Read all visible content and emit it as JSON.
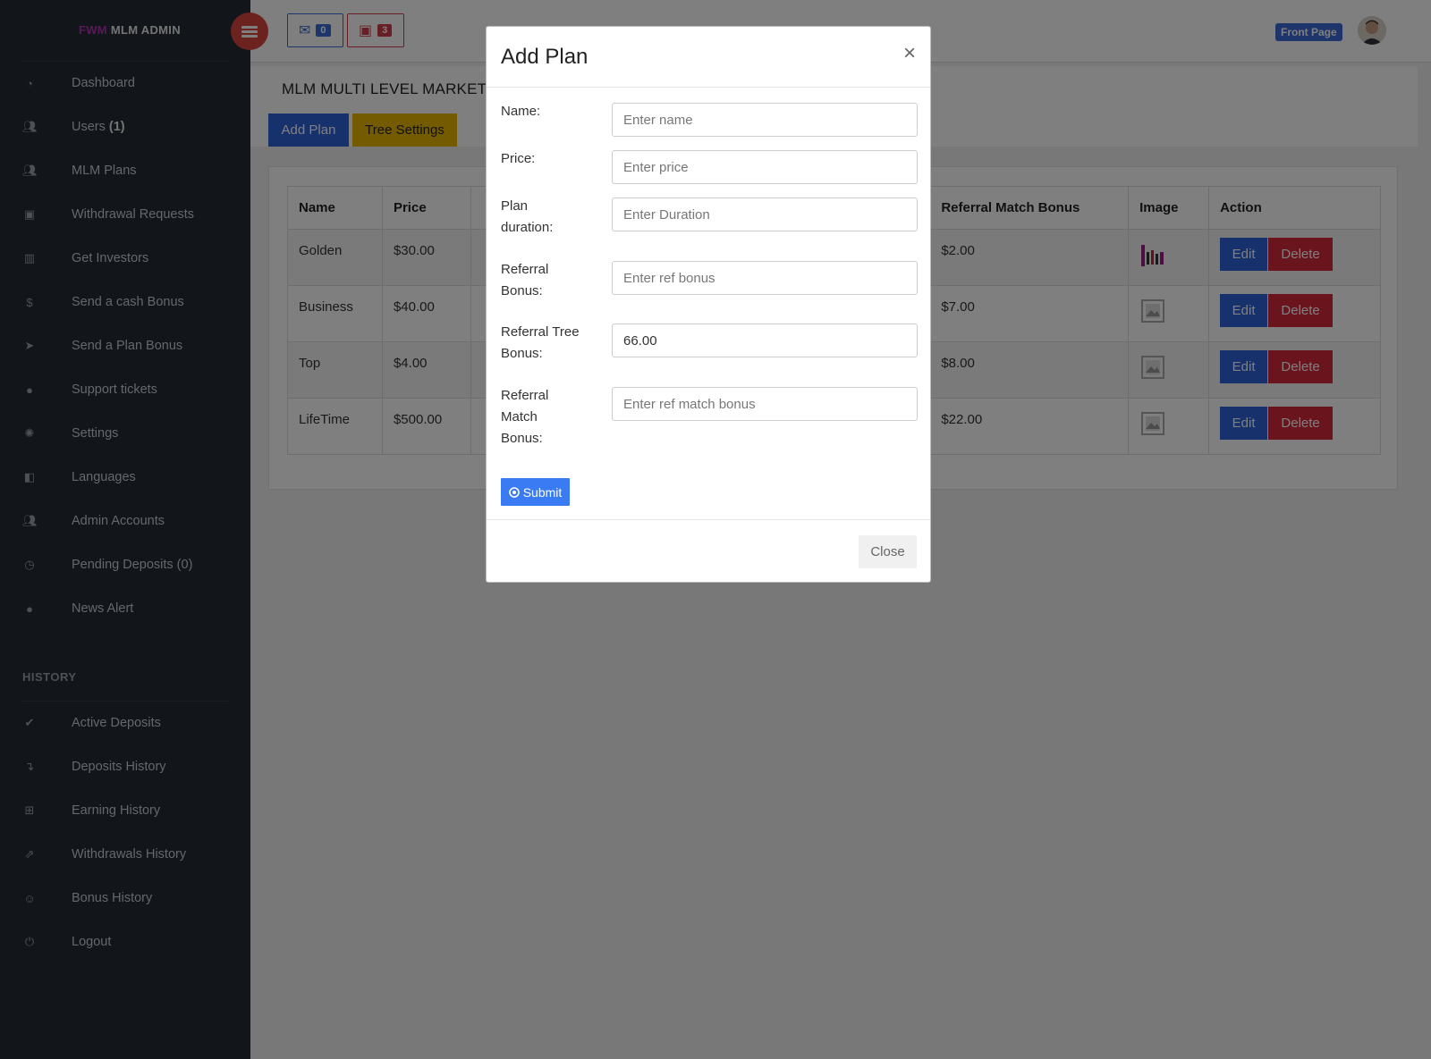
{
  "brand": {
    "prefix": "FWM",
    "name": "MLM ADMIN"
  },
  "sidebar": {
    "items": [
      {
        "label": "Dashboard",
        "icon": "dashboard-icon"
      },
      {
        "label": "Users",
        "count": "(1)",
        "icon": "users-icon"
      },
      {
        "label": "MLM Plans",
        "icon": "users-icon"
      },
      {
        "label": "Withdrawal Requests",
        "icon": "money-icon"
      },
      {
        "label": "Get Investors",
        "icon": "bar-chart-icon"
      },
      {
        "label": "Send a cash Bonus",
        "icon": "dollar-icon"
      },
      {
        "label": "Send a Plan Bonus",
        "icon": "send-icon"
      },
      {
        "label": "Support tickets",
        "icon": "comments-icon"
      },
      {
        "label": "Settings",
        "icon": "gear-icon"
      },
      {
        "label": "Languages",
        "icon": "language-icon"
      },
      {
        "label": "Admin Accounts",
        "icon": "users-icon"
      },
      {
        "label": "Pending Deposits (0)",
        "icon": "clock-icon"
      },
      {
        "label": "News Alert",
        "icon": "comments-icon"
      }
    ],
    "history_title": "HISTORY",
    "history_items": [
      {
        "label": "Active Deposits",
        "icon": "check-icon"
      },
      {
        "label": "Deposits History",
        "icon": "arrow-down-icon"
      },
      {
        "label": "Earning History",
        "icon": "plus-square-icon"
      },
      {
        "label": "Withdrawals History",
        "icon": "share-icon"
      },
      {
        "label": "Bonus History",
        "icon": "smile-icon"
      },
      {
        "label": "Logout",
        "icon": "power-icon"
      }
    ]
  },
  "topbar": {
    "messages_count": "0",
    "money_count": "3",
    "front_page_label": "Front Page"
  },
  "content": {
    "heading": "MLM MULTI LEVEL MARKETING",
    "add_plan_label": "Add Plan",
    "tree_settings_label": "Tree Settings"
  },
  "table": {
    "headers": [
      "Name",
      "Price",
      "",
      "Referral Match Bonus",
      "Image",
      "Action"
    ],
    "rows": [
      {
        "name": "Golden",
        "price": "$30.00",
        "ref_match": "$2.00"
      },
      {
        "name": "Business",
        "price": "$40.00",
        "ref_match": "$7.00"
      },
      {
        "name": "Top",
        "price": "$4.00",
        "ref_match": "$8.00"
      },
      {
        "name": "LifeTime",
        "price": "$500.00",
        "ref_match": "$22.00"
      }
    ],
    "edit_label": "Edit",
    "delete_label": "Delete"
  },
  "modal": {
    "title": "Add Plan",
    "close_x": "×",
    "fields": [
      {
        "label": "Name:",
        "placeholder": "Enter name",
        "value": ""
      },
      {
        "label": "Price:",
        "placeholder": "Enter price",
        "value": ""
      },
      {
        "label": "Plan duration:",
        "placeholder": "Enter Duration",
        "value": ""
      },
      {
        "label": "Referral Bonus:",
        "placeholder": "Enter ref bonus",
        "value": ""
      },
      {
        "label": "Referral Tree Bonus:",
        "placeholder": "",
        "value": "66.00"
      },
      {
        "label": "Referral Match Bonus:",
        "placeholder": "Enter ref match bonus",
        "value": ""
      }
    ],
    "submit_label": "Submit",
    "close_label": "Close"
  },
  "colors": {
    "sidebar_bg": "#242a33",
    "primary": "#2f62d8",
    "danger": "#d5293c",
    "warning": "#e8b400",
    "brand_accent": "#b232b2"
  }
}
